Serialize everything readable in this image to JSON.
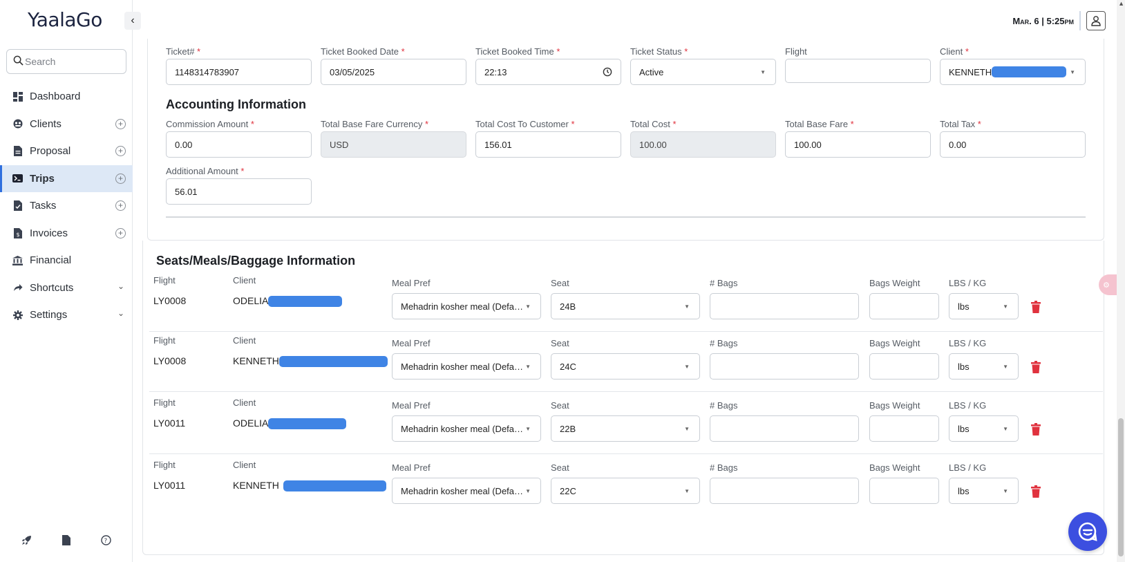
{
  "app": {
    "logo": "YaalaGo"
  },
  "header": {
    "datetime": "Mar. 6 | 5:25pm"
  },
  "sidebar": {
    "search_placeholder": "Search",
    "items": [
      {
        "label": "Dashboard",
        "icon": "dashboard-icon"
      },
      {
        "label": "Clients",
        "icon": "clients-icon"
      },
      {
        "label": "Proposal",
        "icon": "proposal-icon"
      },
      {
        "label": "Trips",
        "icon": "trips-icon"
      },
      {
        "label": "Tasks",
        "icon": "tasks-icon"
      },
      {
        "label": "Invoices",
        "icon": "invoices-icon"
      },
      {
        "label": "Financial",
        "icon": "financial-icon"
      },
      {
        "label": "Shortcuts",
        "icon": "shortcuts-icon"
      },
      {
        "label": "Settings",
        "icon": "settings-icon"
      }
    ]
  },
  "ticket": {
    "ticket_no": {
      "label": "Ticket#",
      "value": "1148314783907"
    },
    "booked_date": {
      "label": "Ticket Booked Date",
      "value": "03/05/2025"
    },
    "booked_time": {
      "label": "Ticket Booked Time",
      "value": "22:13"
    },
    "status": {
      "label": "Ticket Status",
      "value": "Active"
    },
    "flight": {
      "label": "Flight",
      "value": ""
    },
    "client": {
      "label": "Client",
      "value": "KENNETH"
    }
  },
  "accounting": {
    "title": "Accounting Information",
    "commission": {
      "label": "Commission Amount",
      "value": "0.00"
    },
    "base_currency": {
      "label": "Total Base Fare Currency",
      "value": "USD"
    },
    "cost_to_customer": {
      "label": "Total Cost To Customer",
      "value": "156.01"
    },
    "total_cost": {
      "label": "Total Cost",
      "value": "100.00"
    },
    "base_fare": {
      "label": "Total Base Fare",
      "value": "100.00"
    },
    "total_tax": {
      "label": "Total Tax",
      "value": "0.00"
    },
    "additional": {
      "label": "Additional Amount",
      "value": "56.01"
    }
  },
  "smb": {
    "title": "Seats/Meals/Baggage Information",
    "labels": {
      "flight": "Flight",
      "client": "Client",
      "meal": "Meal Pref",
      "seat": "Seat",
      "bags": "# Bags",
      "weight": "Bags Weight",
      "unit": "LBS / KG"
    },
    "rows": [
      {
        "flight": "LY0008",
        "client": "ODELIA",
        "meal": "Mehadrin kosher meal (Defa…",
        "seat": "24B",
        "bags": "",
        "weight": "",
        "unit": "lbs"
      },
      {
        "flight": "LY0008",
        "client": "KENNETH",
        "meal": "Mehadrin kosher meal (Defa…",
        "seat": "24C",
        "bags": "",
        "weight": "",
        "unit": "lbs"
      },
      {
        "flight": "LY0011",
        "client": "ODELIA",
        "meal": "Mehadrin kosher meal (Defa…",
        "seat": "22B",
        "bags": "",
        "weight": "",
        "unit": "lbs"
      },
      {
        "flight": "LY0011",
        "client": "KENNETH",
        "meal": "Mehadrin kosher meal (Defa…",
        "seat": "22C",
        "bags": "",
        "weight": "",
        "unit": "lbs"
      }
    ]
  },
  "colors": {
    "accent": "#2f6fde",
    "required": "#e0323e",
    "delete": "#e0323e",
    "chat": "#3c4fe0"
  }
}
